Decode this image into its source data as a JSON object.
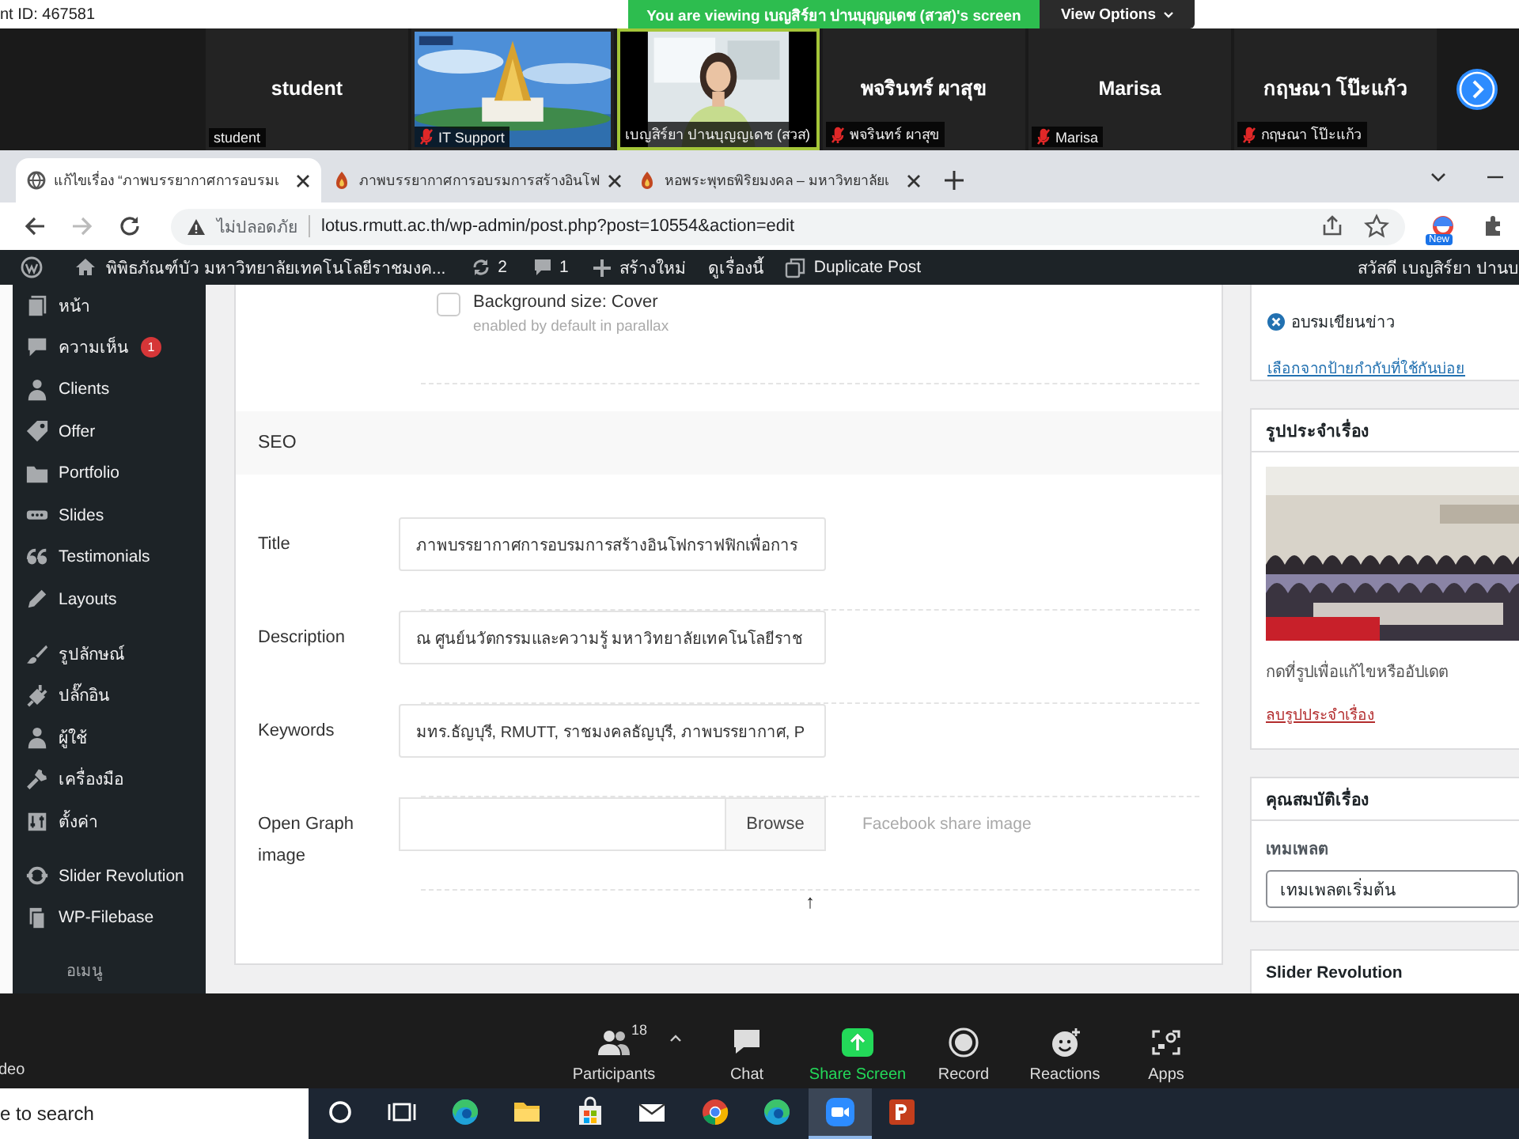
{
  "zoom_header": {
    "meeting_id": "nt ID: 467581",
    "banner": "You are viewing เบญสิร์ยา ปานบุญญเดช (สวส)'s screen",
    "view_options": "View Options"
  },
  "gallery": {
    "tiles": [
      {
        "kind": "name",
        "name": "student",
        "label": "student",
        "muted": false,
        "speaking": false
      },
      {
        "kind": "picture",
        "label": "IT Support",
        "muted": true,
        "speaking": false
      },
      {
        "kind": "picture",
        "label": "เบญสิร์ยา ปานบุญญเดช (สวส)",
        "muted": false,
        "speaking": true
      },
      {
        "kind": "name",
        "name": "พจรินทร์ ผาสุข",
        "label": "พจรินทร์ ผาสุข",
        "muted": true,
        "speaking": false
      },
      {
        "kind": "name",
        "name": "Marisa",
        "label": "Marisa",
        "muted": true,
        "speaking": false
      },
      {
        "kind": "name",
        "name": "กฤษณา โป๊ะแก้ว",
        "label": "กฤษณา โป๊ะแก้ว",
        "muted": true,
        "speaking": false
      }
    ]
  },
  "browser": {
    "tabs": [
      {
        "kind": "globe",
        "title": "แก้ไขเรื่อง “ภาพบรรยากาศการอบรมเ",
        "selected": true
      },
      {
        "kind": "flame",
        "title": "ภาพบรรยากาศการอบรมการสร้างอินโฟ",
        "selected": false
      },
      {
        "kind": "flame",
        "title": "หอพระพุทธพิริยมงคล – มหาวิทยาลัยเ",
        "selected": false
      }
    ],
    "security": "ไม่ปลอดภัย",
    "url": "lotus.rmutt.ac.th/wp-admin/post.php?post=10554&action=edit",
    "extension_badge": "New"
  },
  "admin_bar": {
    "site": "พิพิธภัณฑ์บัว มหาวิทยาลัยเทคโนโลยีราชมงค...",
    "updates": "2",
    "comments": "1",
    "new": "สร้างใหม่",
    "view": "ดูเรื่องนี้",
    "duplicate": "Duplicate Post",
    "greeting": "สวัสดี เบญสิร์ยา ปานบ"
  },
  "menu": {
    "items": [
      {
        "kind": "pages",
        "label": "หน้า",
        "separator_before": false
      },
      {
        "kind": "comments",
        "label": "ความเห็น",
        "badge": "1",
        "separator_before": false
      },
      {
        "kind": "clients",
        "label": "Clients",
        "separator_before": false
      },
      {
        "kind": "offer",
        "label": "Offer",
        "separator_before": false
      },
      {
        "kind": "portfolio",
        "label": "Portfolio",
        "separator_before": false
      },
      {
        "kind": "slides",
        "label": "Slides",
        "separator_before": false
      },
      {
        "kind": "testimonials",
        "label": "Testimonials",
        "separator_before": false
      },
      {
        "kind": "layouts",
        "label": "Layouts",
        "separator_before": false
      },
      {
        "kind": "appearance",
        "label": "รูปลักษณ์",
        "separator_before": true
      },
      {
        "kind": "plugins",
        "label": "ปลั๊กอิน",
        "separator_before": false
      },
      {
        "kind": "users",
        "label": "ผู้ใช้",
        "separator_before": false
      },
      {
        "kind": "tools",
        "label": "เครื่องมือ",
        "separator_before": false
      },
      {
        "kind": "settings",
        "label": "ตั้งค่า",
        "separator_before": false
      },
      {
        "kind": "slider",
        "label": "Slider Revolution",
        "separator_before": true
      },
      {
        "kind": "filebase",
        "label": "WP-Filebase",
        "separator_before": false
      }
    ],
    "collapse": "อเมนู"
  },
  "editor": {
    "option": {
      "label": "Background size: Cover",
      "hint": "enabled by default in parallax",
      "checked": false
    },
    "section": "SEO",
    "fields": [
      {
        "kind": "text",
        "label": "Title",
        "value": "ภาพบรรยากาศการอบรมการสร้างอินโฟกราฟฟิกเพื่อการ"
      },
      {
        "kind": "text",
        "label": "Description",
        "value": "ณ ศูนย์นวัตกรรมและความรู้ มหาวิทยาลัยเทคโนโลยีราช"
      },
      {
        "kind": "text",
        "label": "Keywords",
        "value": "มทร.ธัญบุรี, RMUTT, ราชมงคลธัญบุรี, ภาพบรรยากาศ, P"
      },
      {
        "kind": "file",
        "label": "Open Graph image",
        "button": "Browse",
        "hint": "Facebook share image"
      }
    ],
    "back_to_top": "↑"
  },
  "sidebar": {
    "tags": [
      {
        "label": "อบรมเขียนข่าว"
      }
    ],
    "tags_link": "เลือกจากป้ายกำกับที่ใช้กันบ่อย",
    "featured": {
      "title": "รูปประจำเรื่อง",
      "hint": "กดที่รูปเพื่อแก้ไขหรืออัปเดต",
      "remove_link": "ลบรูปประจำเรื่อง"
    },
    "attributes": {
      "title": "คุณสมบัติเรื่อง",
      "template_label": "เทมเพลต",
      "template": "เทมเพลตเริ่มต้น"
    },
    "next_box": "Slider Revolution"
  },
  "zoom_toolbar": {
    "video": "deo",
    "items": [
      {
        "kind": "participants",
        "label": "Participants",
        "count": "18"
      },
      {
        "kind": "chat",
        "label": "Chat"
      },
      {
        "kind": "share",
        "label": "Share Screen"
      },
      {
        "kind": "record",
        "label": "Record"
      },
      {
        "kind": "reactions",
        "label": "Reactions"
      },
      {
        "kind": "apps",
        "label": "Apps"
      }
    ]
  },
  "taskbar": {
    "placeholder": "e to search",
    "apps": [
      {
        "kind": "cortana",
        "selected": false
      },
      {
        "kind": "taskview",
        "selected": false
      },
      {
        "kind": "edge",
        "selected": false
      },
      {
        "kind": "explorer",
        "selected": false
      },
      {
        "kind": "store",
        "selected": false
      },
      {
        "kind": "mail",
        "selected": false
      },
      {
        "kind": "chrome",
        "selected": false
      },
      {
        "kind": "edge",
        "selected": false
      },
      {
        "kind": "zoom",
        "selected": true
      },
      {
        "kind": "powerpoint",
        "selected": false
      }
    ]
  }
}
